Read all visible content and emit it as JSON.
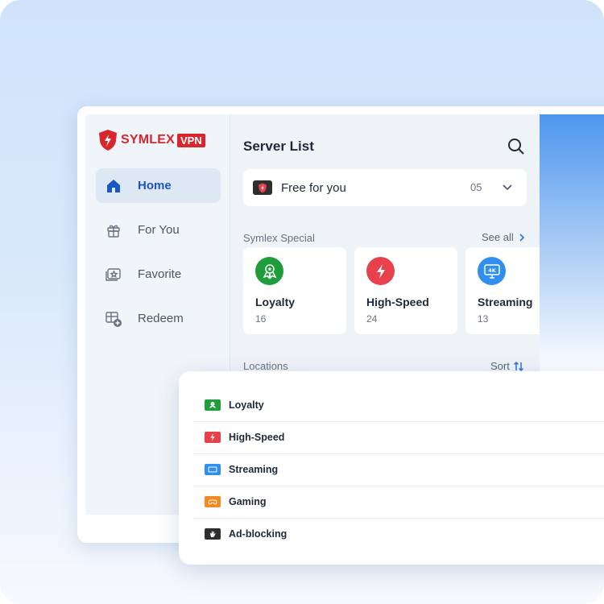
{
  "brand": {
    "name": "SYMLEX",
    "badge": "VPN",
    "color": "#d7262e"
  },
  "sidebar": {
    "items": [
      {
        "label": "Home",
        "icon": "home-icon",
        "active": true
      },
      {
        "label": "For You",
        "icon": "gift-icon",
        "active": false
      },
      {
        "label": "Favorite",
        "icon": "favorite-icon",
        "active": false
      },
      {
        "label": "Redeem",
        "icon": "redeem-icon",
        "active": false
      }
    ]
  },
  "main": {
    "title": "Server List",
    "free": {
      "label": "Free for you",
      "count": "05"
    },
    "special": {
      "label": "Symlex Special",
      "link": "See all",
      "cards": [
        {
          "name": "Loyalty",
          "count": "16",
          "color": "#1f9d3a",
          "icon": "loyalty-icon"
        },
        {
          "name": "High-Speed",
          "count": "24",
          "color": "#e8414b",
          "icon": "lightning-icon"
        },
        {
          "name": "Streaming",
          "count": "13",
          "color": "#2f8ff0",
          "icon": "streaming-icon"
        }
      ]
    },
    "locations": {
      "label": "Locations",
      "link": "Sort"
    }
  },
  "popup": {
    "items": [
      {
        "label": "Loyalty",
        "color": "#1f9d3a",
        "icon": "loyalty-icon"
      },
      {
        "label": "High-Speed",
        "color": "#e8414b",
        "icon": "lightning-icon"
      },
      {
        "label": "Streaming",
        "color": "#2f8ff0",
        "icon": "streaming-icon"
      },
      {
        "label": "Gaming",
        "color": "#f48a1f",
        "icon": "gamepad-icon"
      },
      {
        "label": "Ad-blocking",
        "color": "#2e2e2e",
        "icon": "hand-block-icon"
      }
    ]
  }
}
